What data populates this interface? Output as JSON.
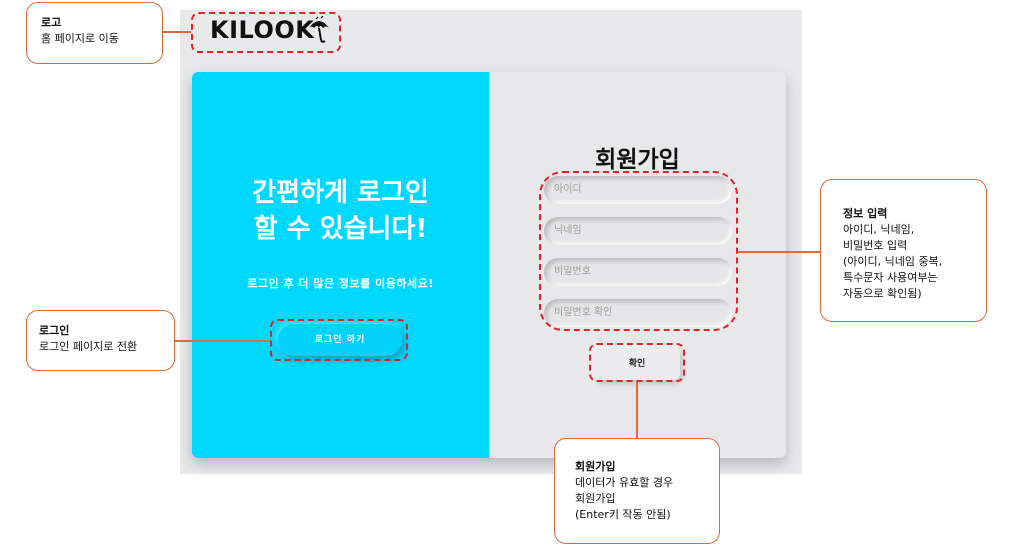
{
  "logo": {
    "text": "KILOOK"
  },
  "left_panel": {
    "headline_line1": "간편하게 로그인",
    "headline_line2": "할 수 있습니다!",
    "subtext": "로그인 후 더 많은 정보를 이용하세요!",
    "login_button": "로그인 하기"
  },
  "signup": {
    "title": "회원가입",
    "fields": [
      {
        "placeholder": "아이디"
      },
      {
        "placeholder": "닉네임"
      },
      {
        "placeholder": "비밀번호"
      },
      {
        "placeholder": "비밀번호 확인"
      }
    ],
    "confirm_button": "확인"
  },
  "annotations": {
    "logo": {
      "title": "로고",
      "lines": [
        "홈 페이지로 이동"
      ]
    },
    "login": {
      "title": "로그인",
      "lines": [
        "로그인 페이지로 전환"
      ]
    },
    "info": {
      "title": "정보 입력",
      "lines": [
        "아이디, 닉네임,",
        "비밀번호 입력",
        "(아이디, 닉네임 중복,",
        "특수문자 사용여부는",
        "자동으로 확인됨)"
      ]
    },
    "signup": {
      "title": "회원가입",
      "lines": [
        "데이터가 유효할 경우",
        "회원가입",
        "(Enter키 작동 안됨)"
      ]
    }
  },
  "colors": {
    "accent": "#00d8ff",
    "highlight": "#e0232a",
    "callout_border": "#e06a3a"
  }
}
